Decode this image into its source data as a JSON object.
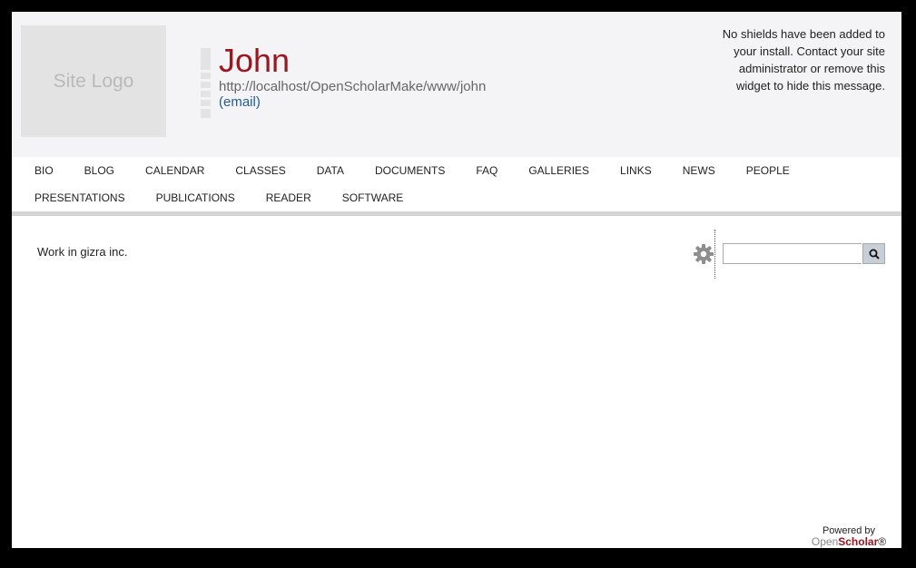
{
  "header": {
    "logo_text": "Site Logo",
    "site_name": "John",
    "site_url": "http://localhost/OpenScholarMake/www/john",
    "email_label": "(email)",
    "shields_message": "No shields have been added to your install. Contact your site administrator or remove this widget to hide this message."
  },
  "nav": {
    "row1": [
      "BIO",
      "BLOG",
      "CALENDAR",
      "CLASSES",
      "DATA",
      "DOCUMENTS",
      "FAQ",
      "GALLERIES",
      "LINKS",
      "NEWS",
      "PEOPLE"
    ],
    "row2": [
      "PRESENTATIONS",
      "PUBLICATIONS",
      "READER",
      "SOFTWARE"
    ]
  },
  "main": {
    "body_text": "Work in gizra inc."
  },
  "search": {
    "icon": "search-icon",
    "settings_icon": "gear-icon"
  },
  "footer": {
    "powered_by": "Powered by",
    "brand_open": "Open",
    "brand_scholar": "Scholar",
    "brand_mark": "®"
  },
  "colors": {
    "site_name": "#9c1620",
    "link": "#1f5d96",
    "header_bg": "#f4f4f6"
  }
}
